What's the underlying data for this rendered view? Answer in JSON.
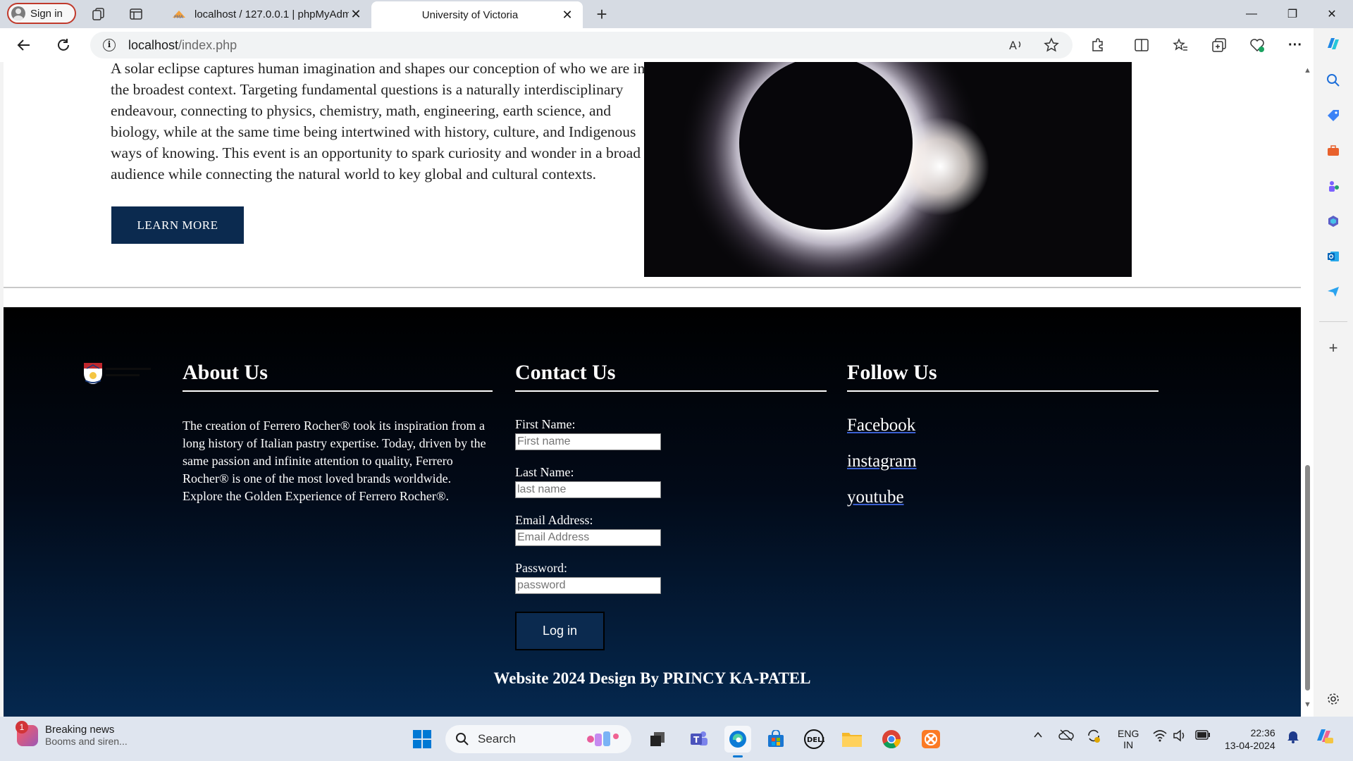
{
  "browser": {
    "signin_label": "Sign in",
    "tabs": [
      {
        "title": "localhost / 127.0.0.1 | phpMyAdmin",
        "close": "✕"
      },
      {
        "title": "University of Victoria",
        "close": "✕"
      }
    ],
    "new_tab": "+",
    "address": {
      "host": "localhost",
      "path": "/index.php"
    },
    "window_controls": {
      "minimize": "—",
      "restore": "❐",
      "close": "✕"
    }
  },
  "page": {
    "intro_text": "A solar eclipse captures human imagination and shapes our conception of who we are in the broadest context. Targeting fundamental questions is a naturally interdisciplinary endeavour, connecting to physics, chemistry, math, engineering, earth science, and biology, while at the same time being intertwined with history, culture, and Indigenous ways of knowing. This event is an opportunity to spark curiosity and wonder in a broad audience while connecting the natural world to key global and cultural contexts.",
    "learn_more": "LEARN MORE",
    "footer": {
      "about": {
        "heading": "About Us",
        "text": "The creation of Ferrero Rocher® took its inspiration from a long history of Italian pastry expertise. Today, driven by the same passion and infinite attention to quality, Ferrero Rocher® is one of the most loved brands worldwide. Explore the Golden Experience of Ferrero Rocher®."
      },
      "contact": {
        "heading": "Contact Us",
        "first_label": "First Name:",
        "first_placeholder": "First name",
        "last_label": "Last Name:",
        "last_placeholder": "last name",
        "email_label": "Email Address:",
        "email_placeholder": "Email Address",
        "password_label": "Password:",
        "password_placeholder": "password",
        "login": "Log in"
      },
      "follow": {
        "heading": "Follow Us",
        "links": [
          "Facebook",
          "instagram",
          "youtube"
        ]
      },
      "credits": "Website 2024 Design By PRINCY KA-PATEL"
    }
  },
  "taskbar": {
    "news_badge": "1",
    "news_title": "Breaking news",
    "news_sub": "Booms and siren...",
    "search_label": "Search",
    "lang_top": "ENG",
    "lang_bottom": "IN",
    "time": "22:36",
    "date": "13-04-2024"
  }
}
